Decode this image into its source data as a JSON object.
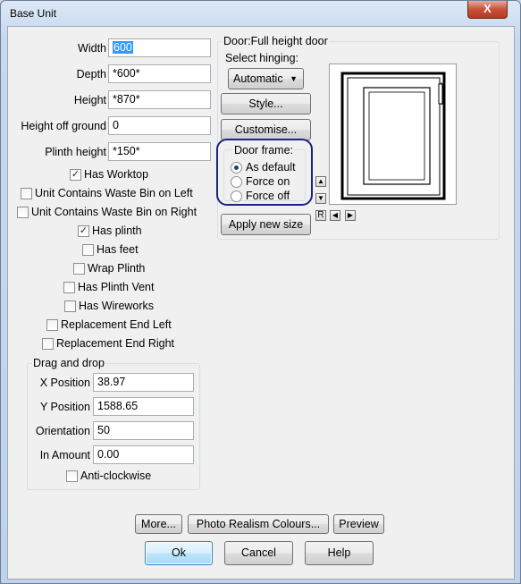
{
  "window": {
    "title": "Base Unit",
    "close_label": "X"
  },
  "fields": [
    {
      "label": "Width",
      "value": "600"
    },
    {
      "label": "Depth",
      "value": "*600*"
    },
    {
      "label": "Height",
      "value": "*870*"
    },
    {
      "label": "Height off ground",
      "value": "0"
    },
    {
      "label": "Plinth height",
      "value": "*150*"
    }
  ],
  "checkboxes": {
    "has_worktop": {
      "label": "Has Worktop",
      "checked": true
    },
    "waste_bin_left": {
      "label": "Unit Contains Waste Bin on Left",
      "checked": false
    },
    "waste_bin_right": {
      "label": "Unit Contains Waste Bin on Right",
      "checked": false
    },
    "has_plinth": {
      "label": "Has plinth",
      "checked": true
    },
    "has_feet": {
      "label": "Has feet",
      "checked": false
    },
    "wrap_plinth": {
      "label": "Wrap Plinth",
      "checked": false
    },
    "has_plinth_vent": {
      "label": "Has Plinth Vent",
      "checked": false
    },
    "has_wireworks": {
      "label": "Has Wireworks",
      "checked": false
    },
    "replacement_end_left": {
      "label": "Replacement End Left",
      "checked": false
    },
    "replacement_end_right": {
      "label": "Replacement End Right",
      "checked": false
    },
    "anti_clockwise": {
      "label": "Anti-clockwise",
      "checked": false
    }
  },
  "drag_drop": {
    "title": "Drag and drop",
    "x_label": "X Position",
    "x_value": "38.97",
    "y_label": "Y Position",
    "y_value": "1588.65",
    "orientation_label": "Orientation",
    "orientation_value": "50",
    "in_amount_label": "In Amount",
    "in_amount_value": "0.00"
  },
  "door": {
    "group_title": "Door:Full height door",
    "hinging_label": "Select hinging:",
    "hinging_value": "Automatic",
    "style_button": "Style...",
    "customise_button": "Customise...",
    "frame_title": "Door frame:",
    "frame_options": [
      "As default",
      "Force on",
      "Force off"
    ],
    "frame_selected": 0,
    "apply_button": "Apply new size",
    "reset_label": "R"
  },
  "bottom_buttons": {
    "more": "More...",
    "photo_realism": "Photo Realism Colours...",
    "preview": "Preview",
    "ok": "Ok",
    "cancel": "Cancel",
    "help": "Help"
  },
  "colors": {
    "highlight_ring": "#1a237e",
    "selection": "#3399ff"
  }
}
